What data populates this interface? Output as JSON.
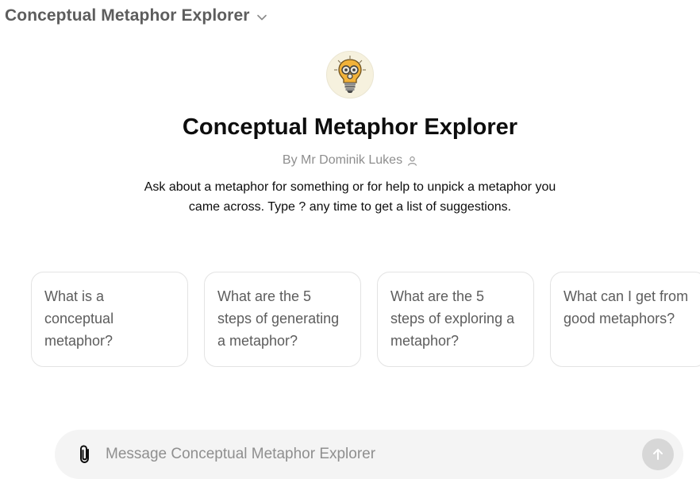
{
  "header": {
    "title": "Conceptual Metaphor Explorer",
    "chevron_icon": "chevron-down-icon"
  },
  "gpt": {
    "logo_icon": "lightbulb-gears-logo",
    "name": "Conceptual Metaphor Explorer",
    "author": "By Mr Dominik Lukes",
    "author_icon": "person-icon",
    "description": "Ask about a metaphor for something or for help to unpick a metaphor you came across. Type ? any time to get a list of suggestions."
  },
  "suggestions": [
    "What is a conceptual metaphor?",
    "What are the 5 steps of generating a metaphor?",
    "What are the 5 steps of exploring a metaphor?",
    "What can I get from good metaphors?"
  ],
  "composer": {
    "placeholder": "Message Conceptual Metaphor Explorer",
    "value": "",
    "attach_icon": "paperclip-icon",
    "send_icon": "arrow-up-icon"
  },
  "colors": {
    "composer_bg": "#f4f4f4",
    "send_disabled": "#d7d7d7",
    "muted_text": "#8e8e8e"
  }
}
